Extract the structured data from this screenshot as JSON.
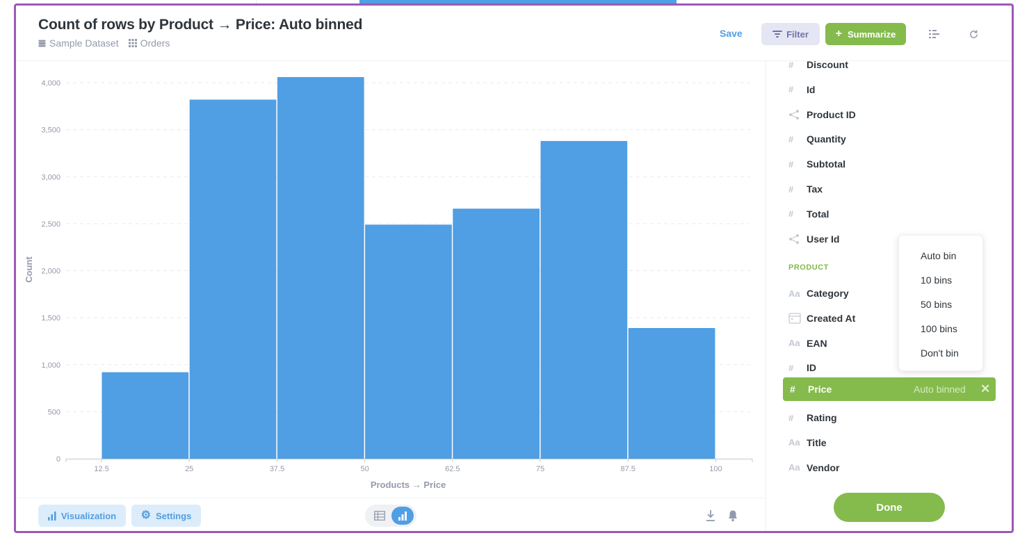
{
  "header": {
    "title": "Count of rows by Product → Price: Auto binned",
    "breadcrumbs": [
      "Sample Dataset",
      "Orders"
    ],
    "save_label": "Save",
    "filter_label": "Filter",
    "summarize_label": "Summarize"
  },
  "footer": {
    "visualization_label": "Visualization",
    "settings_label": "Settings"
  },
  "sidebar": {
    "fields_top": [
      {
        "icon": "#",
        "label": "Discount"
      },
      {
        "icon": "#",
        "label": "Id"
      },
      {
        "icon": "share",
        "label": "Product ID"
      },
      {
        "icon": "#",
        "label": "Quantity"
      },
      {
        "icon": "#",
        "label": "Subtotal"
      },
      {
        "icon": "#",
        "label": "Tax"
      },
      {
        "icon": "#",
        "label": "Total"
      },
      {
        "icon": "share",
        "label": "User Id"
      }
    ],
    "section_label": "PRODUCT",
    "fields_product": [
      {
        "icon": "Aa",
        "label": "Category"
      },
      {
        "icon": "calendar",
        "label": "Created At"
      },
      {
        "icon": "Aa",
        "label": "EAN"
      },
      {
        "icon": "#",
        "label": "ID"
      }
    ],
    "selected_field": {
      "icon": "#",
      "label": "Price",
      "binning": "Auto binned"
    },
    "fields_after": [
      {
        "icon": "#",
        "label": "Rating"
      },
      {
        "icon": "Aa",
        "label": "Title"
      },
      {
        "icon": "Aa",
        "label": "Vendor"
      }
    ],
    "done_label": "Done"
  },
  "binning_menu": {
    "options": [
      "Auto bin",
      "10 bins",
      "50 bins",
      "100 bins",
      "Don't bin"
    ]
  },
  "colors": {
    "bar": "#509ee3",
    "accent_green": "#84bb4c",
    "frame": "#9b59b6"
  },
  "chart_data": {
    "type": "bar",
    "x_edges": [
      12.5,
      25,
      37.5,
      50,
      62.5,
      75,
      87.5,
      100
    ],
    "x_tick_labels": [
      "12.5",
      "25",
      "37.5",
      "50",
      "62.5",
      "75",
      "87.5",
      "100"
    ],
    "values": [
      920,
      3820,
      4060,
      2490,
      2660,
      3380,
      1390
    ],
    "ylim": [
      0,
      4000
    ],
    "y_ticks": [
      0,
      500,
      1000,
      1500,
      2000,
      2500,
      3000,
      3500,
      4000
    ],
    "y_tick_labels": [
      "0",
      "500",
      "1,000",
      "1,500",
      "2,000",
      "2,500",
      "3,000",
      "3,500",
      "4,000"
    ],
    "xlabel": "Products → Price",
    "ylabel": "Count",
    "grid": true
  }
}
